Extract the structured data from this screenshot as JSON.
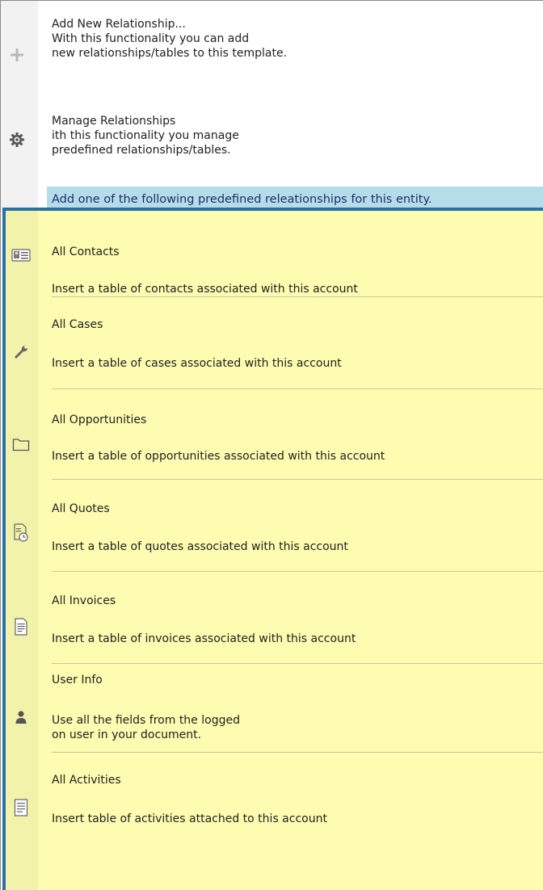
{
  "top_items": [
    {
      "title": "Add New Relationship...",
      "desc_line1": "With this functionality you can add",
      "desc_line2": "new relationships/tables to this template.",
      "icon": "plus-icon"
    },
    {
      "title": "Manage Relationships",
      "desc_line1": "ith this functionality you manage",
      "desc_line2": "predefined relationships/tables.",
      "icon": "gear-icon"
    }
  ],
  "predefined_header": "Add one of the following predefined releationships for this entity.",
  "relationships": [
    {
      "title": "All Contacts",
      "desc": "Insert a table of contacts associated with this account",
      "icon": "contact-card-icon"
    },
    {
      "title": "All Cases",
      "desc": "Insert a table of cases associated with this account",
      "icon": "wrench-icon"
    },
    {
      "title": "All Opportunities",
      "desc": "Insert a table of opportunities associated with this account",
      "icon": "folder-icon"
    },
    {
      "title": "All Quotes",
      "desc": "Insert a table of quotes associated with this account",
      "icon": "quote-document-clock-icon"
    },
    {
      "title": "All Invoices",
      "desc": "Insert a table of invoices associated with this account",
      "icon": "invoice-document-icon"
    },
    {
      "title": "User Info",
      "desc_line1": "Use all the fields from the logged",
      "desc_line2": "on user in your document.",
      "icon": "user-icon"
    },
    {
      "title": "All Activities",
      "desc": "Insert table of activities attached to this account",
      "icon": "activity-list-icon"
    }
  ],
  "colors": {
    "highlight_background": "#fdfcb0",
    "highlight_border": "#2a6ea6",
    "header_background": "#b7dce9",
    "header_text": "#1a2f6a"
  }
}
